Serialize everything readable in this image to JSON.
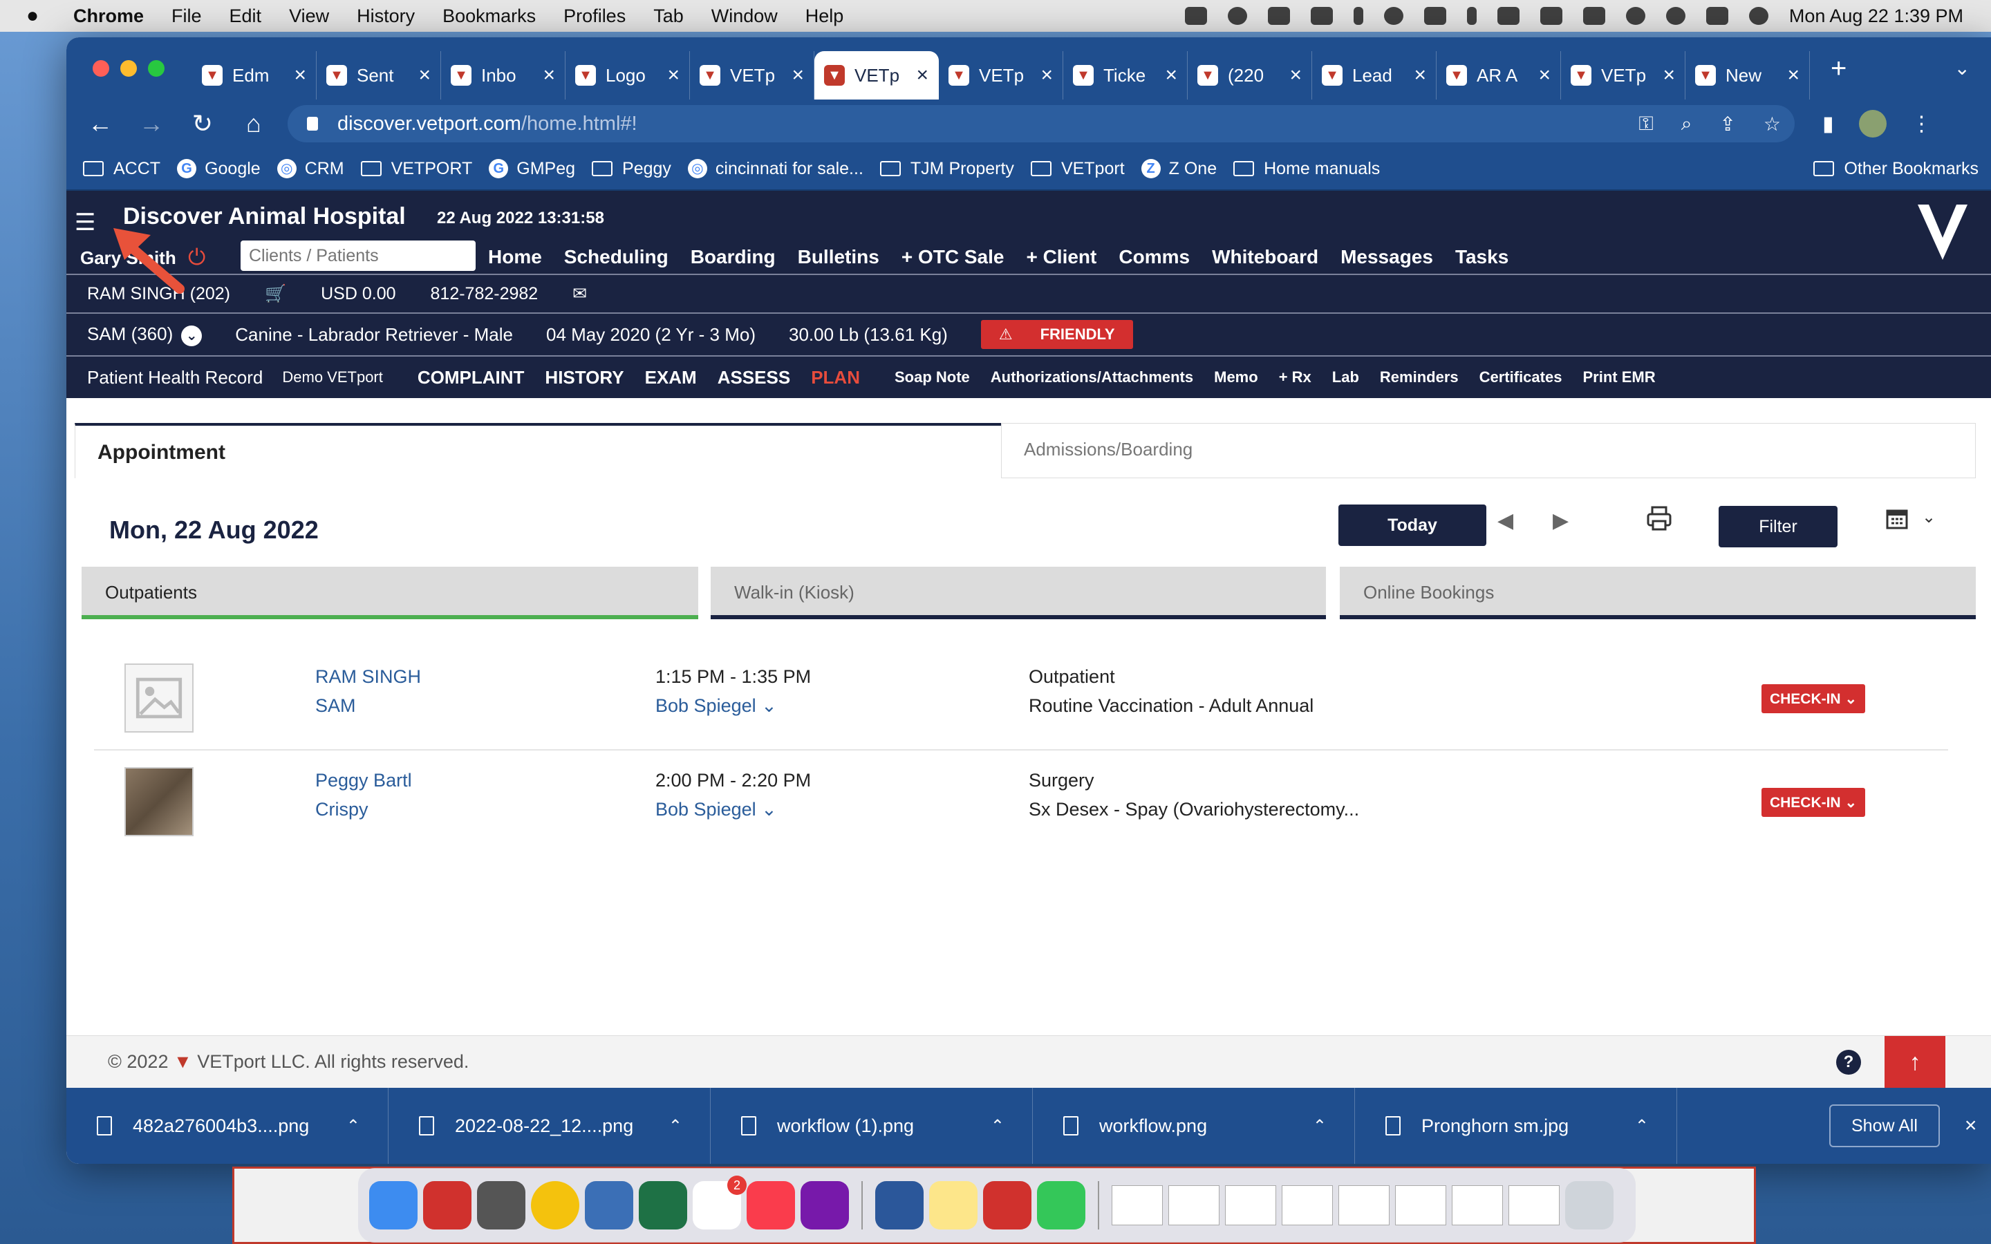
{
  "menubar": {
    "app": "Chrome",
    "items": [
      "File",
      "Edit",
      "View",
      "History",
      "Bookmarks",
      "Profiles",
      "Tab",
      "Window",
      "Help"
    ],
    "clock": "Mon Aug 22  1:39 PM"
  },
  "tabs": [
    {
      "label": "Edm"
    },
    {
      "label": "Sent"
    },
    {
      "label": "Inbo"
    },
    {
      "label": "Logo"
    },
    {
      "label": "VETp"
    },
    {
      "label": "VETp",
      "active": true
    },
    {
      "label": "VETp"
    },
    {
      "label": "Ticke"
    },
    {
      "label": "(220"
    },
    {
      "label": "Lead"
    },
    {
      "label": "AR A"
    },
    {
      "label": "VETp"
    },
    {
      "label": "New"
    }
  ],
  "address": {
    "host": "discover.vetport.com",
    "path": "/home.html#!"
  },
  "bookmarks": [
    {
      "label": "ACCT",
      "icon": "folder-icon"
    },
    {
      "label": "Google",
      "icon": "google-icon"
    },
    {
      "label": "CRM",
      "icon": "crm-icon"
    },
    {
      "label": "VETPORT",
      "icon": "folder-icon"
    },
    {
      "label": "GMPeg",
      "icon": "google-icon"
    },
    {
      "label": "Peggy",
      "icon": "folder-icon"
    },
    {
      "label": "cincinnati for sale...",
      "icon": "peace-icon"
    },
    {
      "label": "TJM Property",
      "icon": "folder-icon"
    },
    {
      "label": "VETport",
      "icon": "folder-icon"
    },
    {
      "label": "Z One",
      "icon": "z-icon"
    },
    {
      "label": "Home manuals",
      "icon": "folder-icon"
    }
  ],
  "other_bookmarks": "Other Bookmarks",
  "app": {
    "title": "Discover Animal Hospital",
    "timestamp": "22 Aug 2022 13:31:58",
    "user": "Gary Smith",
    "search_placeholder": "Clients / Patients",
    "nav": [
      "Home",
      "Scheduling",
      "Boarding",
      "Bulletins",
      "+ OTC Sale",
      "+ Client",
      "Comms",
      "Whiteboard",
      "Messages",
      "Tasks"
    ]
  },
  "client": {
    "name": "RAM SINGH (202)",
    "balance": "USD 0.00",
    "phone": "812-782-2982"
  },
  "patient": {
    "name": "SAM (360)",
    "breed": "Canine - Labrador Retriever - Male",
    "dob": "04 May 2020 (2 Yr - 3 Mo)",
    "weight": "30.00 Lb (13.61 Kg)",
    "alert": "FRIENDLY"
  },
  "record": {
    "label": "Patient Health Record",
    "demo": "Demo VETport",
    "big": [
      "COMPLAINT",
      "HISTORY",
      "EXAM",
      "ASSESS"
    ],
    "plan": "PLAN",
    "small": [
      "Soap Note",
      "Authorizations/Attachments",
      "Memo",
      "+ Rx",
      "Lab",
      "Reminders",
      "Certificates",
      "Print EMR"
    ]
  },
  "panel_tabs": {
    "active": "Appointment",
    "other": "Admissions/Boarding"
  },
  "schedule": {
    "date": "Mon, 22 Aug 2022",
    "today_label": "Today",
    "filter_label": "Filter",
    "subtabs": [
      "Outpatients",
      "Walk-in (Kiosk)",
      "Online Bookings"
    ]
  },
  "appointments": [
    {
      "client": "RAM SINGH",
      "patient": "SAM",
      "time": "1:15 PM - 1:35 PM",
      "vet": "Bob Spiegel",
      "type": "Outpatient",
      "reason": "Routine Vaccination - Adult Annual",
      "action": "CHECK-IN"
    },
    {
      "client": "Peggy Bartl",
      "patient": "Crispy",
      "time": "2:00 PM - 2:20 PM",
      "vet": "Bob Spiegel",
      "type": "Surgery",
      "reason": "Sx Desex - Spay (Ovariohysterectomy...",
      "action": "CHECK-IN"
    }
  ],
  "footer": {
    "copyright": "© 2022",
    "company": "VETport LLC. All rights reserved."
  },
  "downloads": [
    "482a276004b3....png",
    "2022-08-22_12....png",
    "workflow (1).png",
    "workflow.png",
    "Pronghorn sm.jpg"
  ],
  "downloads_show_all": "Show All",
  "dock_badge": "2",
  "colors": {
    "navy": "#1a2341",
    "accent_red": "#d32f2f",
    "link_blue": "#2a5c9a",
    "chrome_blue": "#1f4e8e"
  }
}
